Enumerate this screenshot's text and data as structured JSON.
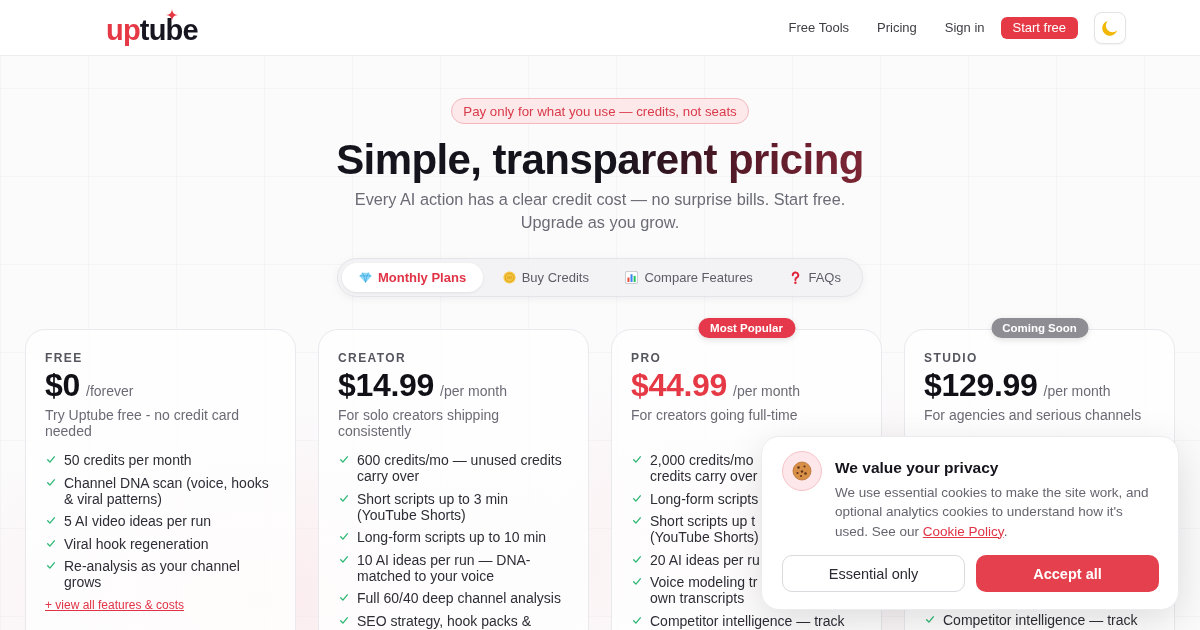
{
  "header": {
    "logo": {
      "accent": "up",
      "rest": "tube"
    },
    "nav": [
      {
        "label": "Free Tools"
      },
      {
        "label": "Pricing"
      },
      {
        "label": "Sign in"
      }
    ],
    "cta": "Start free"
  },
  "hero": {
    "badge": "Pay only for what you use — credits, not seats",
    "title": "Simple, transparent pricing",
    "subtitle": "Every AI action has a clear credit cost — no surprise bills. Start free. Upgrade as you grow."
  },
  "tabs": [
    {
      "kind": "gem",
      "label": "Monthly Plans",
      "selected": true
    },
    {
      "kind": "coin",
      "label": "Buy Credits",
      "selected": false
    },
    {
      "kind": "chart",
      "label": "Compare Features",
      "selected": false
    },
    {
      "kind": "question",
      "label": "FAQs",
      "selected": false
    }
  ],
  "plans": [
    {
      "tier": "FREE",
      "price": "$0",
      "period": "/forever",
      "description": "Try Uptube free - no credit card needed",
      "highlight": false,
      "features": [
        "50 credits per month",
        "Channel DNA scan (voice, hooks & viral patterns)",
        "5 AI video ideas per run",
        "Viral hook regeneration",
        "Re-analysis as your channel grows"
      ],
      "link": "+ view all features & costs"
    },
    {
      "tier": "CREATOR",
      "price": "$14.99",
      "period": "/per month",
      "description": "For solo creators shipping consistently",
      "highlight": false,
      "features": [
        "600 credits/mo — unused credits carry over",
        "Short scripts up to 3 min (YouTube Shorts)",
        "Long-form scripts up to 10 min",
        "10 AI ideas per run — DNA-matched to your voice",
        "Full 60/40 deep channel analysis",
        "SEO strategy, hook packs &"
      ]
    },
    {
      "tier": "PRO",
      "ribbon": {
        "kind": "popular",
        "label": "Most Popular"
      },
      "price": "$44.99",
      "period": "/per month",
      "description": "For creators going full-time",
      "highlight": true,
      "features": [
        "2,000 credits/mo\ncredits carry over",
        "Long-form scripts",
        "Short scripts up t\n(YouTube Shorts)",
        "20 AI ideas per ru",
        "Voice modeling tr\nown transcripts",
        "Competitor intelligence — track"
      ]
    },
    {
      "tier": "STUDIO",
      "ribbon": {
        "kind": "soon",
        "label": "Coming Soon"
      },
      "price": "$129.99",
      "period": "/per month",
      "description": "For agencies and serious channels",
      "highlight": false,
      "features": [
        "Competitor intelligence — track"
      ]
    }
  ],
  "cookie_banner": {
    "title": "We value your privacy",
    "text": "We use essential cookies to make the site work, and optional analytics cookies to understand how it's used. See our",
    "link": "Cookie Policy",
    "text_end": ".",
    "buttons": [
      {
        "kind": "secondary",
        "label": "Essential only"
      },
      {
        "kind": "primary",
        "label": "Accept all"
      }
    ]
  }
}
